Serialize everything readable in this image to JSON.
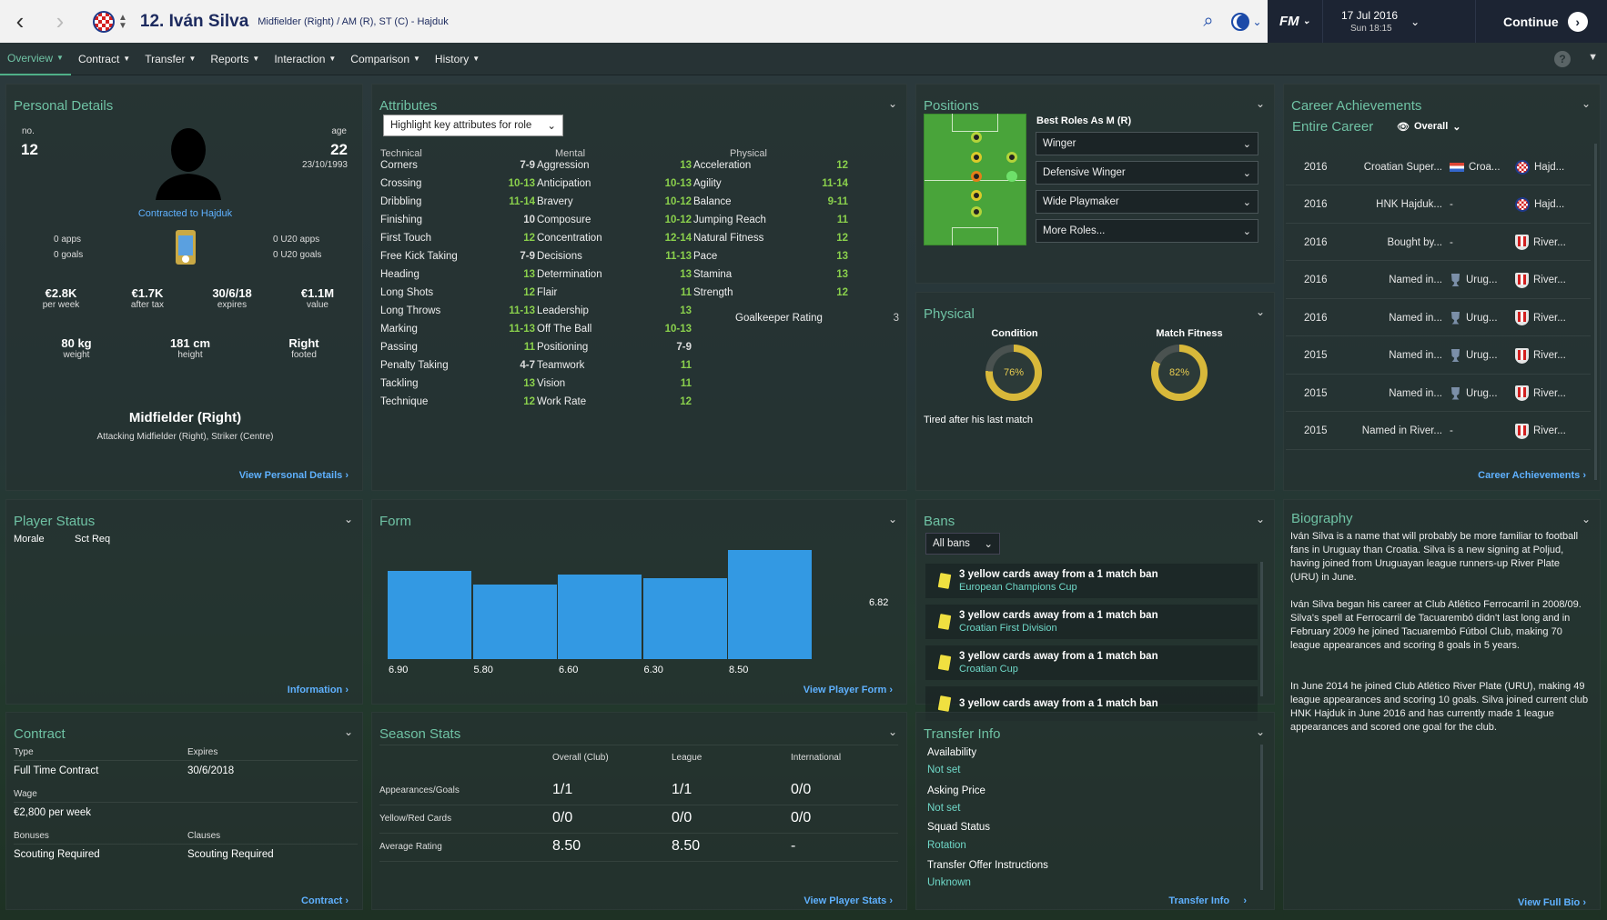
{
  "header": {
    "player_name": "12. Iván Silva",
    "positions": "Midfielder (Right) / AM (R), ST (C) - Hajduk",
    "date": "17 Jul 2016",
    "time": "Sun 18:15",
    "continue": "Continue",
    "fm": "FM"
  },
  "tabs": [
    "Overview",
    "Contract",
    "Transfer",
    "Reports",
    "Interaction",
    "Comparison",
    "History"
  ],
  "help": "?",
  "personal": {
    "title": "Personal Details",
    "no_label": "no.",
    "no": "12",
    "age_label": "age",
    "age": "22",
    "dob": "23/10/1993",
    "contracted": "Contracted to Hajduk",
    "apps": "0 apps",
    "goals": "0 goals",
    "u20apps": "0 U20 apps",
    "u20goals": "0 U20 goals",
    "wage": "€2.8K",
    "wage_l": "per week",
    "after": "€1.7K",
    "after_l": "after tax",
    "expires": "30/6/18",
    "expires_l": "expires",
    "value": "€1.1M",
    "value_l": "value",
    "weight": "80 kg",
    "weight_l": "weight",
    "height": "181 cm",
    "height_l": "height",
    "foot": "Right",
    "foot_l": "footed",
    "position": "Midfielder (Right)",
    "position_sub": "Attacking Midfielder (Right), Striker (Centre)",
    "link": "View Personal Details"
  },
  "attributes": {
    "title": "Attributes",
    "highlight": "Highlight key attributes for role",
    "technical_h": "Technical",
    "mental_h": "Mental",
    "physical_h": "Physical",
    "technical": [
      [
        "Corners",
        "7-9"
      ],
      [
        "Crossing",
        "10-13"
      ],
      [
        "Dribbling",
        "11-14"
      ],
      [
        "Finishing",
        "10"
      ],
      [
        "First Touch",
        "12"
      ],
      [
        "Free Kick Taking",
        "7-9"
      ],
      [
        "Heading",
        "13"
      ],
      [
        "Long Shots",
        "12"
      ],
      [
        "Long Throws",
        "11-13"
      ],
      [
        "Marking",
        "11-13"
      ],
      [
        "Passing",
        "11"
      ],
      [
        "Penalty Taking",
        "4-7"
      ],
      [
        "Tackling",
        "13"
      ],
      [
        "Technique",
        "12"
      ]
    ],
    "mental": [
      [
        "Aggression",
        "13"
      ],
      [
        "Anticipation",
        "10-13"
      ],
      [
        "Bravery",
        "10-12"
      ],
      [
        "Composure",
        "10-12"
      ],
      [
        "Concentration",
        "12-14"
      ],
      [
        "Decisions",
        "11-13"
      ],
      [
        "Determination",
        "13"
      ],
      [
        "Flair",
        "11"
      ],
      [
        "Leadership",
        "13"
      ],
      [
        "Off The Ball",
        "10-13"
      ],
      [
        "Positioning",
        "7-9"
      ],
      [
        "Teamwork",
        "11"
      ],
      [
        "Vision",
        "11"
      ],
      [
        "Work Rate",
        "12"
      ]
    ],
    "physical": [
      [
        "Acceleration",
        "12"
      ],
      [
        "Agility",
        "11-14"
      ],
      [
        "Balance",
        "9-11"
      ],
      [
        "Jumping Reach",
        "11"
      ],
      [
        "Natural Fitness",
        "12"
      ],
      [
        "Pace",
        "13"
      ],
      [
        "Stamina",
        "13"
      ],
      [
        "Strength",
        "12"
      ]
    ],
    "gk_label": "Goalkeeper Rating",
    "gk": "3"
  },
  "positions": {
    "title": "Positions",
    "best_roles": "Best Roles As M (R)",
    "roles": [
      "Winger",
      "Defensive Winger",
      "Wide Playmaker",
      "More Roles..."
    ]
  },
  "physical": {
    "title": "Physical",
    "condition_l": "Condition",
    "condition": "76%",
    "condition_val": 76,
    "fitness_l": "Match Fitness",
    "fitness": "82%",
    "fitness_val": 82,
    "note": "Tired after his last match"
  },
  "career": {
    "title": "Career Achievements",
    "entire": "Entire Career",
    "overall": "Overall",
    "link": "Career Achievements",
    "rows": [
      [
        "2016",
        "Croatian Super...",
        "Croa...",
        "Hajd..."
      ],
      [
        "2016",
        "HNK Hajduk...",
        "-",
        "Hajd..."
      ],
      [
        "2016",
        "Bought by...",
        "-",
        "River..."
      ],
      [
        "2016",
        "Named in...",
        "Urug...",
        "River..."
      ],
      [
        "2016",
        "Named in...",
        "Urug...",
        "River..."
      ],
      [
        "2015",
        "Named in...",
        "Urug...",
        "River..."
      ],
      [
        "2015",
        "Named in...",
        "Urug...",
        "River..."
      ],
      [
        "2015",
        "Named in River...",
        "-",
        "River..."
      ]
    ]
  },
  "status": {
    "title": "Player Status",
    "morale": "Morale",
    "sct": "Sct Req",
    "link": "Information"
  },
  "form": {
    "title": "Form",
    "avg": "6.82",
    "link": "View Player Form"
  },
  "chart_data": {
    "type": "bar",
    "categories": [
      "6.90",
      "5.80",
      "6.60",
      "6.30",
      "8.50"
    ],
    "values": [
      6.9,
      5.8,
      6.6,
      6.3,
      8.5
    ],
    "series": [
      {
        "name": "",
        "values": [
          6.9,
          5.8,
          6.6,
          6.3,
          8.5
        ]
      }
    ],
    "ylim": [
      0,
      8.5
    ],
    "title": "",
    "avg_label": "6.82"
  },
  "bans": {
    "title": "Bans",
    "filter": "All bans",
    "rows": [
      [
        "3 yellow cards away from a 1 match ban",
        "European Champions Cup"
      ],
      [
        "3 yellow cards away from a 1 match ban",
        "Croatian First Division"
      ],
      [
        "3 yellow cards away from a 1 match ban",
        "Croatian Cup"
      ],
      [
        "3 yellow cards away from a 1 match ban",
        ""
      ]
    ]
  },
  "biography": {
    "title": "Biography",
    "p1": "Iván Silva is a name that will probably be more familiar to football fans in Uruguay than Croatia. Silva is a new signing at Poljud, having joined from Uruguayan league runners-up River Plate (URU) in June.",
    "p2": "Iván Silva began his career at Club Atlético Ferrocarril in 2008/09. Silva's spell at Ferrocarril de Tacuarembó didn't last long and in February 2009 he joined Tacuarembó Fútbol Club, making 70 league appearances and scoring 8 goals in 5 years.",
    "p3": "In June 2014 he joined Club Atlético River Plate (URU), making 49 league appearances and scoring 10 goals. Silva joined current club HNK Hajduk in June 2016 and has currently made 1 league appearances and scored one goal for the club.",
    "link": "View Full Bio"
  },
  "contract": {
    "title": "Contract",
    "type_l": "Type",
    "type": "Full Time Contract",
    "expires_l": "Expires",
    "expires": "30/6/2018",
    "wage_l": "Wage",
    "wage": "€2,800 per week",
    "bonuses_l": "Bonuses",
    "bonuses": "Scouting Required",
    "clauses_l": "Clauses",
    "clauses": "Scouting Required",
    "link": "Contract"
  },
  "season": {
    "title": "Season Stats",
    "cols": [
      "Overall (Club)",
      "League",
      "International"
    ],
    "rows": [
      [
        "Appearances/Goals",
        "1/1",
        "1/1",
        "0/0"
      ],
      [
        "Yellow/Red Cards",
        "0/0",
        "0/0",
        "0/0"
      ],
      [
        "Average Rating",
        "8.50",
        "8.50",
        "-"
      ]
    ],
    "link": "View Player Stats"
  },
  "transfer": {
    "title": "Transfer Info",
    "availability_l": "Availability",
    "availability": "Not set",
    "price_l": "Asking Price",
    "price": "Not set",
    "squad_l": "Squad Status",
    "squad": "Rotation",
    "offer_l": "Transfer Offer Instructions",
    "offer": "Unknown",
    "link": "Transfer Info"
  }
}
